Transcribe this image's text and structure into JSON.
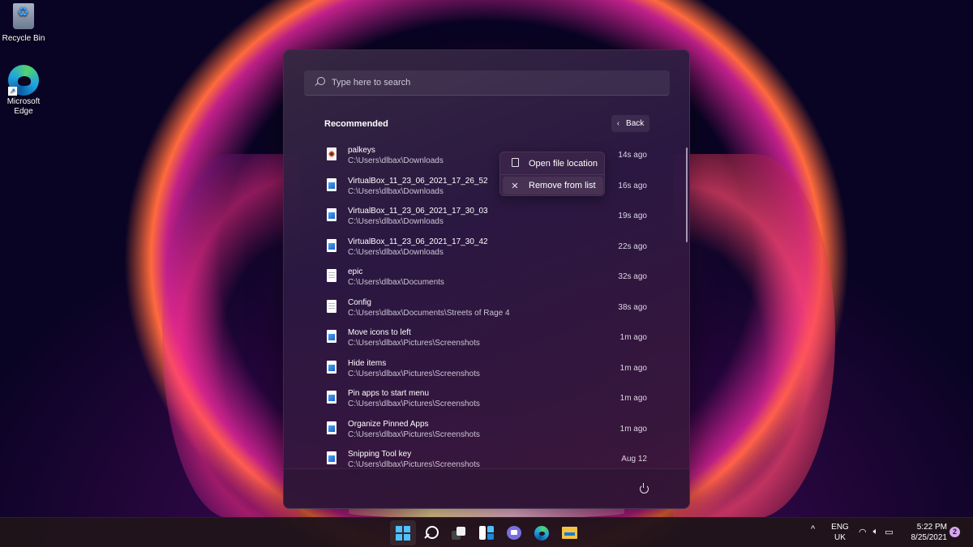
{
  "desktop": {
    "icons": [
      {
        "label": "Recycle Bin",
        "icon": "recycle-bin-icon"
      },
      {
        "label": "Microsoft Edge",
        "icon": "edge-icon",
        "shortcut": true
      }
    ]
  },
  "start_menu": {
    "search": {
      "placeholder": "Type here to search",
      "value": ""
    },
    "recommended": {
      "title": "Recommended",
      "back_label": "Back",
      "items": [
        {
          "name": "palkeys",
          "path": "C:\\Users\\dlbax\\Downloads",
          "time": "14s ago",
          "icon": "app-file-icon"
        },
        {
          "name": "VirtualBox_11_23_06_2021_17_26_52",
          "path": "C:\\Users\\dlbax\\Downloads",
          "time": "16s ago",
          "icon": "image-file-icon"
        },
        {
          "name": "VirtualBox_11_23_06_2021_17_30_03",
          "path": "C:\\Users\\dlbax\\Downloads",
          "time": "19s ago",
          "icon": "image-file-icon"
        },
        {
          "name": "VirtualBox_11_23_06_2021_17_30_42",
          "path": "C:\\Users\\dlbax\\Downloads",
          "time": "22s ago",
          "icon": "image-file-icon"
        },
        {
          "name": "epic",
          "path": "C:\\Users\\dlbax\\Documents",
          "time": "32s ago",
          "icon": "text-file-icon"
        },
        {
          "name": "Config",
          "path": "C:\\Users\\dlbax\\Documents\\Streets of Rage 4",
          "time": "38s ago",
          "icon": "text-file-icon"
        },
        {
          "name": "Move icons to left",
          "path": "C:\\Users\\dlbax\\Pictures\\Screenshots",
          "time": "1m ago",
          "icon": "image-file-icon"
        },
        {
          "name": "Hide items",
          "path": "C:\\Users\\dlbax\\Pictures\\Screenshots",
          "time": "1m ago",
          "icon": "image-file-icon"
        },
        {
          "name": "Pin apps to start menu",
          "path": "C:\\Users\\dlbax\\Pictures\\Screenshots",
          "time": "1m ago",
          "icon": "image-file-icon"
        },
        {
          "name": "Organize Pinned Apps",
          "path": "C:\\Users\\dlbax\\Pictures\\Screenshots",
          "time": "1m ago",
          "icon": "image-file-icon"
        },
        {
          "name": "Snipping Tool key",
          "path": "C:\\Users\\dlbax\\Pictures\\Screenshots",
          "time": "Aug 12",
          "icon": "image-file-icon"
        }
      ]
    },
    "context_menu": {
      "items": [
        {
          "label": "Open file location",
          "icon": "open-folder-icon"
        },
        {
          "label": "Remove from list",
          "icon": "close-icon"
        }
      ]
    },
    "footer": {
      "power_icon": "power-icon"
    }
  },
  "taskbar": {
    "apps": [
      "start-icon",
      "search-icon",
      "task-view-icon",
      "widgets-icon",
      "chat-icon",
      "edge-icon",
      "file-explorer-icon"
    ],
    "tray": {
      "chevron": "^",
      "language_line1": "ENG",
      "language_line2": "UK",
      "time": "5:22 PM",
      "date": "8/25/2021",
      "notification_count": "2"
    }
  }
}
